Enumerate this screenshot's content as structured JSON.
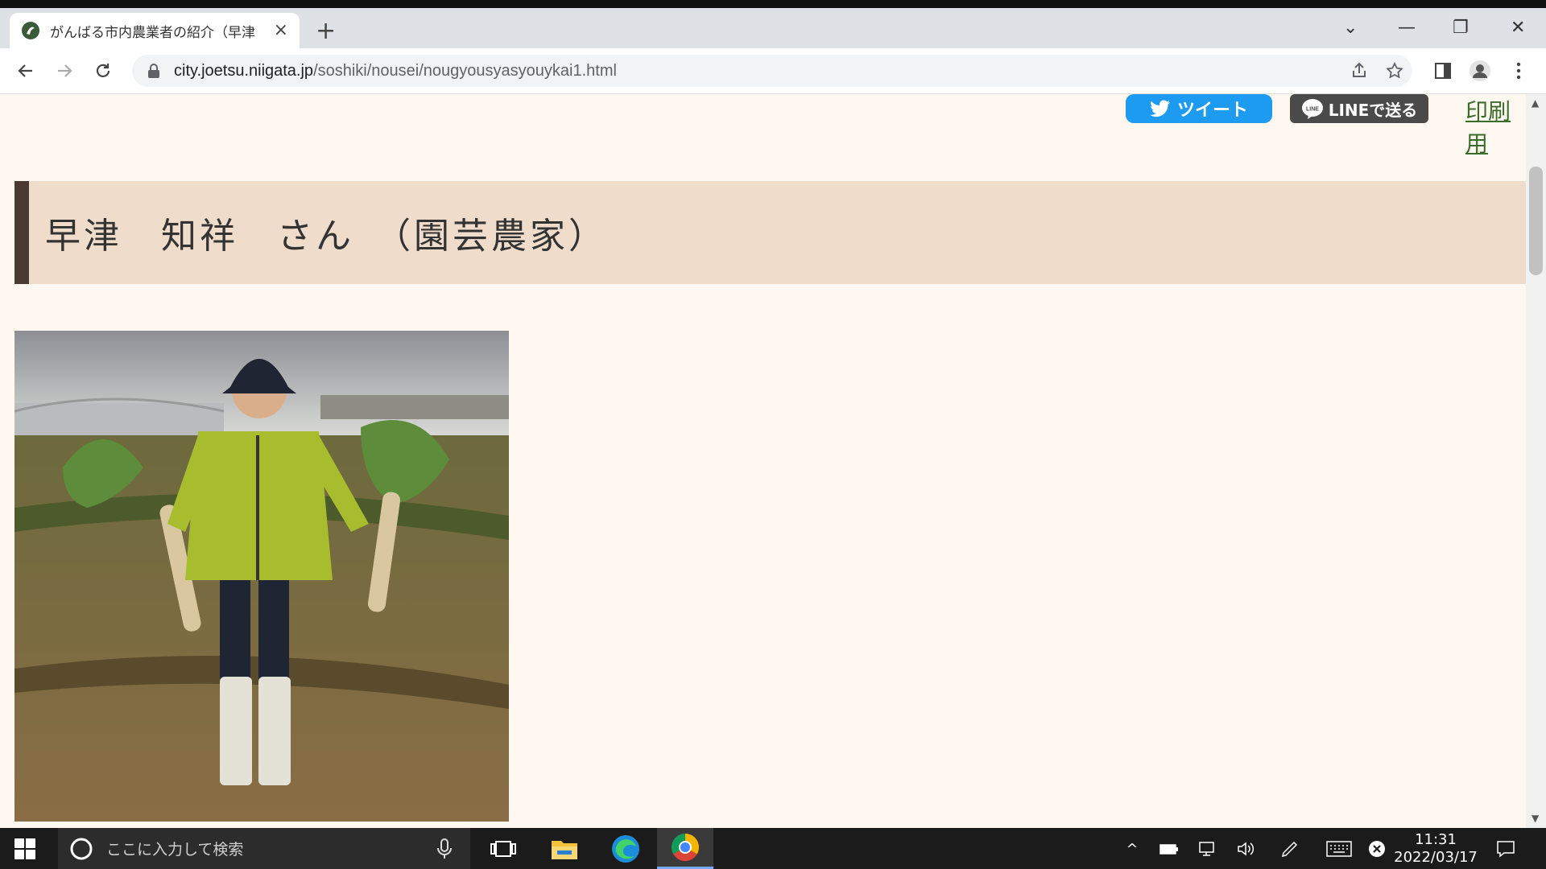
{
  "browser": {
    "tab_title": "がんばる市内農業者の紹介（早津",
    "tab_close": "×",
    "new_tab": "+",
    "url_host": "city.joetsu.niigata.jp",
    "url_path": "/soshiki/nousei/nougyousyasyouykai1.html",
    "window_controls": {
      "dropdown": "⌄",
      "minimize": "—",
      "restore": "❐",
      "close": "✕"
    }
  },
  "page": {
    "share": {
      "tweet_label": "ツイート",
      "line_label": "LINEで送る",
      "print_label": "印刷用"
    },
    "heading": "早津　知祥　さん　（園芸農家）",
    "photo": {
      "icon": "farmer-photo"
    }
  },
  "taskbar": {
    "search_placeholder": "ここに入力して検索",
    "clock_time": "11:31",
    "clock_date": "2022/03/17"
  },
  "colors": {
    "page_bg": "#fff8f1",
    "heading_bg": "#f0dcca",
    "heading_bar": "#4b3a31",
    "tweet_blue": "#1d9bf0",
    "line_gray": "#4a4a4a",
    "print_link": "#3b6d2a"
  }
}
